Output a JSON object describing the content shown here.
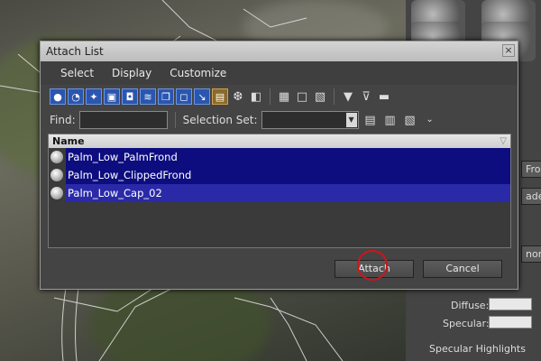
{
  "dialog": {
    "title": "Attach List",
    "close_glyph": "×",
    "menu": [
      "Select",
      "Display",
      "Customize"
    ],
    "find_label": "Find:",
    "find_value": "",
    "selection_set_label": "Selection Set:",
    "selection_set_value": "",
    "list_header": "Name",
    "items": [
      "Palm_Low_PalmFrond",
      "Palm_Low_ClippedFrond",
      "Palm_Low_Cap_02"
    ],
    "attach_label": "Attach",
    "cancel_label": "Cancel"
  },
  "toolbar_icons": [
    "geometry-icon",
    "shapes-icon",
    "lights-icon",
    "cameras-icon",
    "helpers-icon",
    "spacewarps-icon",
    "groups-icon",
    "xrefs-icon",
    "bones-icon",
    "containers-icon",
    "frozen-icon",
    "hidden-icon",
    "display-all-icon",
    "display-none-icon",
    "invert-display-icon",
    "filter-icon",
    "filter-settings-icon",
    "collapse-icon"
  ],
  "command_panel": {
    "diffuse_label": "Diffuse:",
    "specular_label": "Specular:",
    "specular_highlights_label": "Specular Highlights",
    "frond_label": "Frond",
    "shader_label": "ader",
    "phong_label": "nong"
  },
  "colors": {
    "selection_blue": "#0d0d80",
    "annotation_red": "#d0141b",
    "dialog_bg": "#444444"
  }
}
